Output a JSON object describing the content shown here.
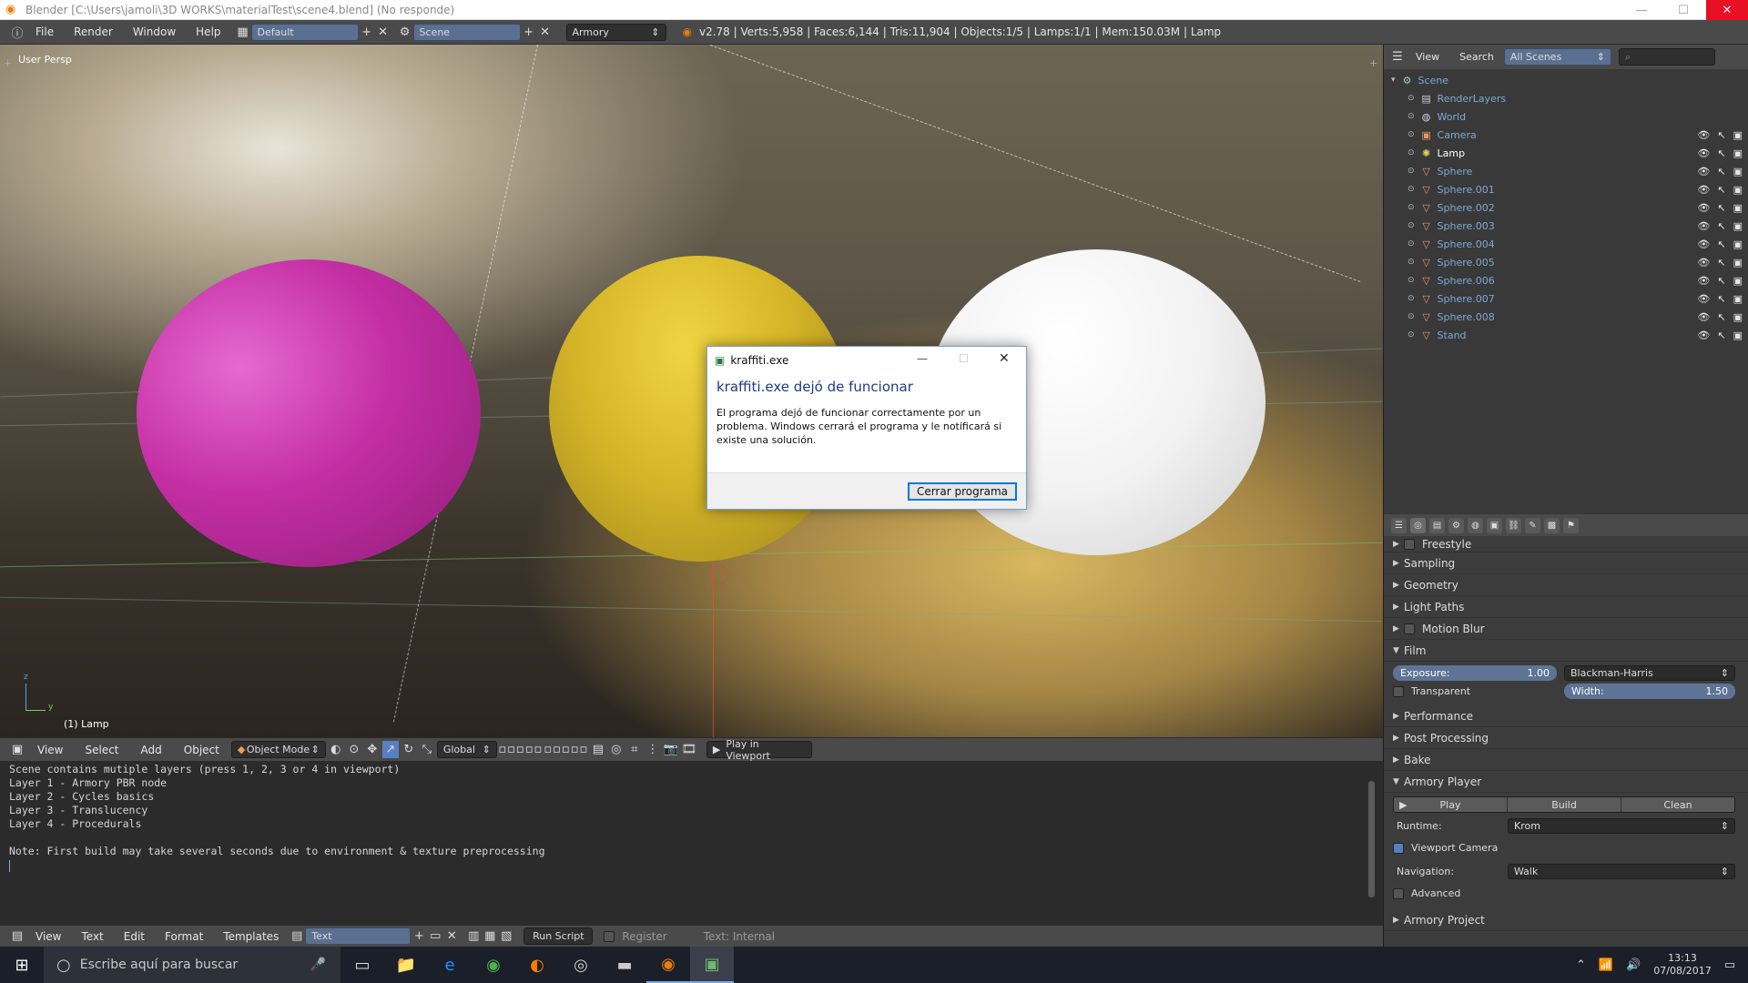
{
  "window": {
    "title": "Blender [C:\\Users\\jamoli\\3D WORKS\\materialTest\\scene4.blend] (No responde)"
  },
  "infobar": {
    "menus": [
      "File",
      "Render",
      "Window",
      "Help"
    ],
    "layout": "Default",
    "scene": "Scene",
    "engine": "Armory",
    "stats": "v2.78 | Verts:5,958 | Faces:6,144 | Tris:11,904 | Objects:1/5 | Lamps:1/1 | Mem:150.03M | Lamp"
  },
  "viewport": {
    "view_label": "User Persp",
    "object_label": "(1) Lamp",
    "axis_z": "z",
    "axis_y": "y"
  },
  "dialog": {
    "title": "kraffiti.exe",
    "heading": "kraffiti.exe dejó de funcionar",
    "body": "El programa dejó de funcionar correctamente por un problema. Windows cerrará el programa y le notificará si existe una solución.",
    "button": "Cerrar programa"
  },
  "outliner": {
    "menus": [
      "View",
      "Search"
    ],
    "filter": "All Scenes",
    "items": [
      {
        "label": "Scene",
        "icon": "scene-icon",
        "indent": 0
      },
      {
        "label": "RenderLayers",
        "icon": "renderlayers-icon",
        "indent": 1
      },
      {
        "label": "World",
        "icon": "world-icon",
        "indent": 1
      },
      {
        "label": "Camera",
        "icon": "camera-icon",
        "indent": 1
      },
      {
        "label": "Lamp",
        "icon": "lamp-icon",
        "indent": 1
      },
      {
        "label": "Sphere",
        "icon": "mesh-icon",
        "indent": 1
      },
      {
        "label": "Sphere.001",
        "icon": "mesh-icon",
        "indent": 1
      },
      {
        "label": "Sphere.002",
        "icon": "mesh-icon",
        "indent": 1
      },
      {
        "label": "Sphere.003",
        "icon": "mesh-icon",
        "indent": 1
      },
      {
        "label": "Sphere.004",
        "icon": "mesh-icon",
        "indent": 1
      },
      {
        "label": "Sphere.005",
        "icon": "mesh-icon",
        "indent": 1
      },
      {
        "label": "Sphere.006",
        "icon": "mesh-icon",
        "indent": 1
      },
      {
        "label": "Sphere.007",
        "icon": "mesh-icon",
        "indent": 1
      },
      {
        "label": "Sphere.008",
        "icon": "mesh-icon",
        "indent": 1
      },
      {
        "label": "Stand",
        "icon": "mesh-icon",
        "indent": 1
      }
    ]
  },
  "properties": {
    "sections": {
      "freestyle": "Freestyle",
      "sampling": "Sampling",
      "geometry": "Geometry",
      "light_paths": "Light Paths",
      "motion_blur": "Motion Blur",
      "film": "Film",
      "performance": "Performance",
      "post_processing": "Post Processing",
      "bake": "Bake",
      "armory_player": "Armory Player",
      "armory_project": "Armory Project"
    },
    "film": {
      "exposure_label": "Exposure:",
      "exposure_value": "1.00",
      "filter": "Blackman-Harris",
      "transparent": "Transparent",
      "width_label": "Width:",
      "width_value": "1.50"
    },
    "player": {
      "play": "Play",
      "build": "Build",
      "clean": "Clean",
      "runtime_label": "Runtime:",
      "runtime": "Krom",
      "viewport_camera": "Viewport Camera",
      "navigation_label": "Navigation:",
      "navigation": "Walk",
      "advanced": "Advanced"
    }
  },
  "viewport_header": {
    "menus": [
      "View",
      "Select",
      "Add",
      "Object"
    ],
    "mode": "Object Mode",
    "orientation": "Global",
    "play": "Play in Viewport"
  },
  "console": {
    "lines": [
      "Scene contains mutiple layers (press 1, 2, 3 or 4 in viewport)",
      "Layer 1 - Armory PBR node",
      "Layer 2 - Cycles basics",
      "Layer 3 - Translucency",
      "Layer 4 - Procedurals",
      "",
      "Note: First build may take several seconds due to environment & texture preprocessing"
    ]
  },
  "text_header": {
    "menus": [
      "View",
      "Text",
      "Edit",
      "Format",
      "Templates"
    ],
    "datablock": "Text",
    "run": "Run Script",
    "register": "Register",
    "internal": "Text: Internal"
  },
  "taskbar": {
    "search": "Escribe aquí para buscar",
    "time": "13:13",
    "date": "07/08/2017"
  },
  "colors": {
    "blender_orange": "#e87d0d",
    "selection_blue": "#5680c2",
    "outliner_text": "#7ca9d8",
    "sphere_magenta": "#c42ea4",
    "sphere_yellow": "#d6b628",
    "sphere_white": "#f2f2f2"
  }
}
